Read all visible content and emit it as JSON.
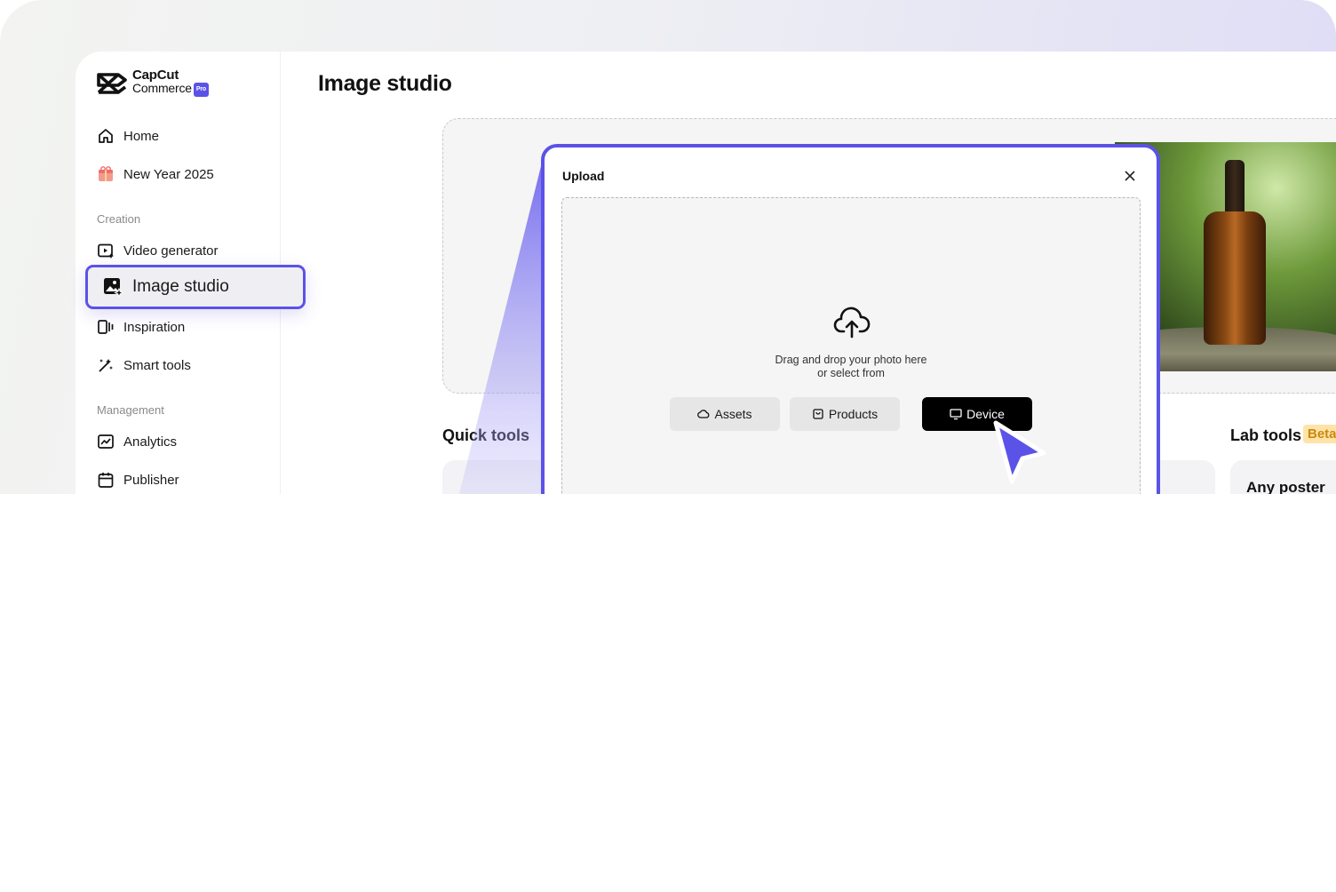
{
  "brand": {
    "line1": "CapCut",
    "line2": "Commerce",
    "badge": "Pro"
  },
  "sidebar": {
    "items_top": [
      {
        "label": "Home",
        "icon": "home-icon"
      },
      {
        "label": "New Year 2025",
        "icon": "gift-icon"
      }
    ],
    "creation_label": "Creation",
    "creation_items": [
      {
        "label": "Video generator",
        "icon": "video-generator-icon"
      },
      {
        "label": "Image studio",
        "icon": "image-studio-icon",
        "active": true
      },
      {
        "label": "Inspiration",
        "icon": "inspiration-icon"
      },
      {
        "label": "Smart tools",
        "icon": "magic-wand-icon"
      }
    ],
    "management_label": "Management",
    "management_items": [
      {
        "label": "Analytics",
        "icon": "analytics-icon"
      },
      {
        "label": "Publisher",
        "icon": "calendar-icon"
      }
    ]
  },
  "main": {
    "title": "Image studio",
    "quick_tools_label": "Quick tools",
    "lab_tools_label": "Lab tools",
    "beta_label": "Beta",
    "card_title": "Any poster"
  },
  "modal": {
    "title": "Upload",
    "hint_line1": "Drag and drop your photo here",
    "hint_line2": "or select from",
    "buttons": [
      {
        "label": "Assets",
        "icon": "cloud-icon"
      },
      {
        "label": "Products",
        "icon": "bag-icon"
      },
      {
        "label": "Device",
        "icon": "monitor-icon",
        "primary": true
      }
    ]
  },
  "colors": {
    "accent": "#5b52e8",
    "primary_button": "#000000"
  }
}
